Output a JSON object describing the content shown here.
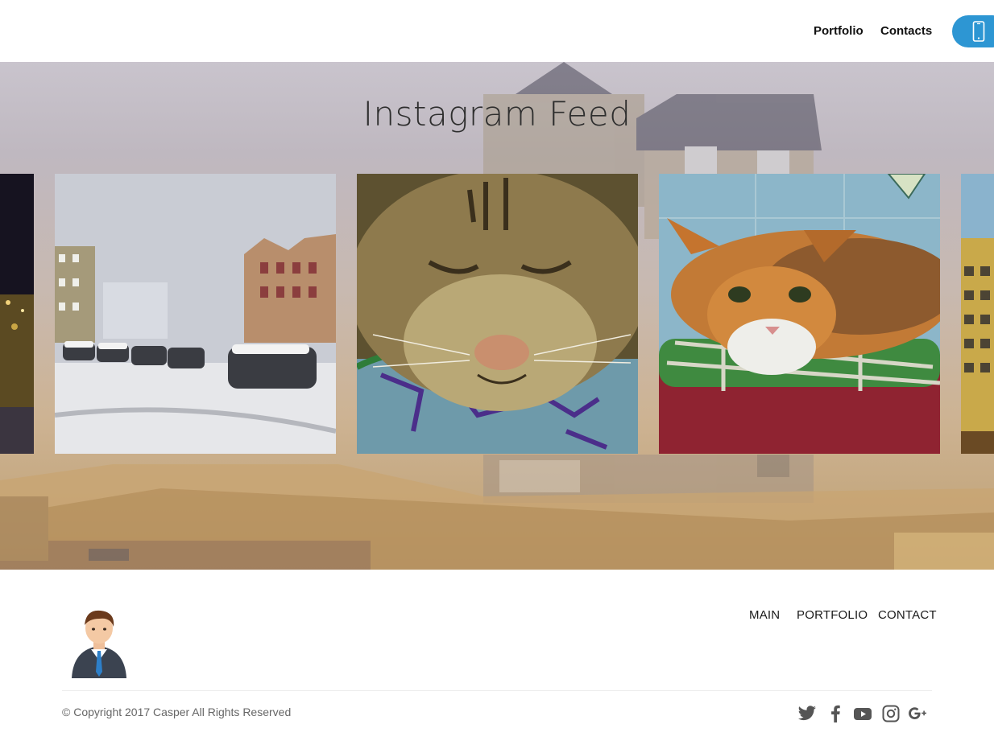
{
  "header": {
    "nav": [
      {
        "label": "Portfolio"
      },
      {
        "label": "Contacts"
      }
    ],
    "phone_icon": "mobile-phone-icon",
    "accent_color": "#2d96d3"
  },
  "hero": {
    "title": "Instagram Feed",
    "slides": [
      {
        "subject": "city-night-lights"
      },
      {
        "subject": "snowy-parking-lot"
      },
      {
        "subject": "tabby-cat-closeup"
      },
      {
        "subject": "calico-cat-on-blanket"
      },
      {
        "subject": "apartment-building"
      }
    ]
  },
  "footer": {
    "nav": [
      {
        "label": "MAIN"
      },
      {
        "label": "PORTFOLIO"
      },
      {
        "label": "CONTACT"
      }
    ],
    "copyright": "© Copyright 2017 Casper  All Rights Reserved",
    "social": [
      "twitter-icon",
      "facebook-icon",
      "youtube-icon",
      "instagram-icon",
      "google-plus-icon"
    ]
  }
}
